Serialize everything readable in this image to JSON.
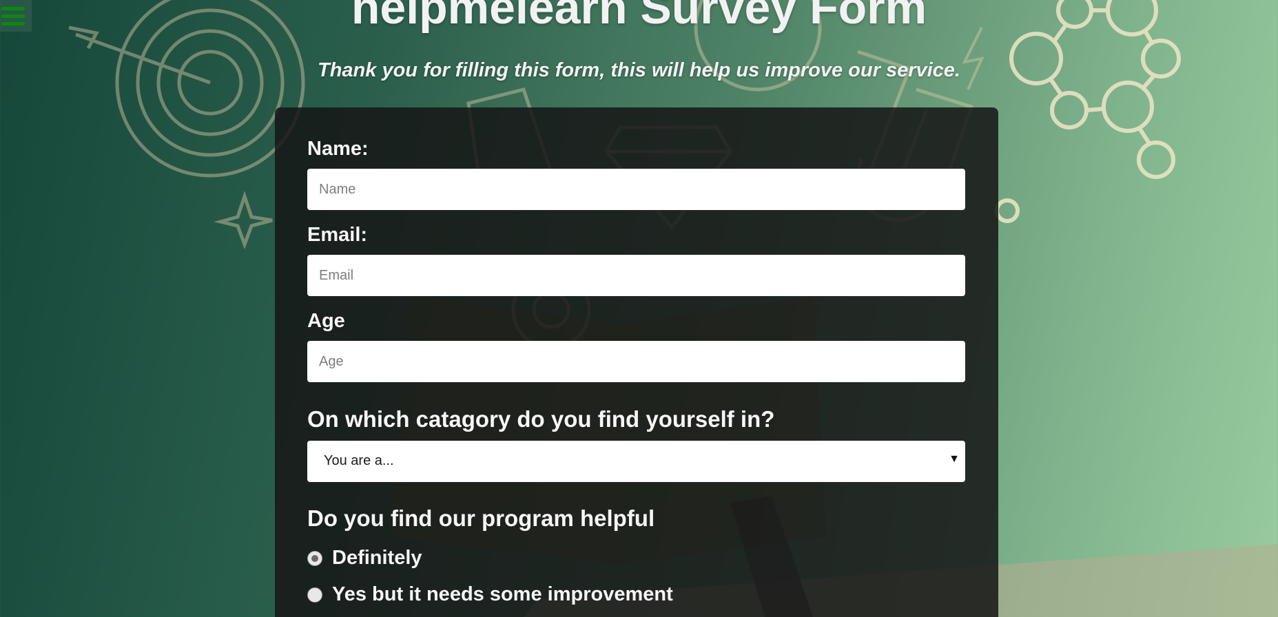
{
  "header": {
    "title": "helpmelearn Survey Form",
    "subtitle": "Thank you for filling this form, this will help us improve our service."
  },
  "menu": {
    "icon": "hamburger-menu-icon",
    "color": "#0a8a0a"
  },
  "form": {
    "name": {
      "label": "Name:",
      "placeholder": "Name",
      "value": ""
    },
    "email": {
      "label": "Email:",
      "placeholder": "Email",
      "value": ""
    },
    "age": {
      "label": "Age",
      "placeholder": "Age",
      "value": ""
    },
    "category": {
      "question": "On which catagory do you find yourself in?",
      "selected": "You are a..."
    },
    "helpful": {
      "question": "Do you find our program helpful",
      "options": [
        {
          "label": "Definitely",
          "checked": true
        },
        {
          "label": "Yes but it needs some improvement",
          "checked": false
        }
      ]
    }
  },
  "colors": {
    "card": "#161616",
    "background_dark": "#16473a",
    "background_light": "#98cc9e",
    "doodle": "#d9c9a8"
  }
}
